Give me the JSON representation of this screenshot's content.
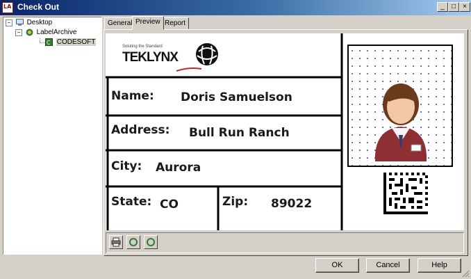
{
  "window": {
    "title": "Check Out",
    "app_icon_text": "LA",
    "controls": {
      "minimize": "_",
      "restore": "□",
      "close": "×"
    }
  },
  "tree": {
    "items": [
      {
        "label": "Desktop",
        "expander": "−",
        "icon": "desktop-icon"
      },
      {
        "label": "LabelArchive",
        "expander": "−",
        "icon": "label-archive-icon"
      },
      {
        "label": "CODESOFT",
        "icon": "codesoft-icon",
        "selected": true
      }
    ]
  },
  "tabs": [
    {
      "label": "General"
    },
    {
      "label": "Preview",
      "active": true
    },
    {
      "label": "Report"
    }
  ],
  "label_preview": {
    "logo_tagline": "Soluting the Standard",
    "logo_text": "TEKLYNX",
    "name_label": "Name:",
    "name_value": "Doris Samuelson",
    "address_label": "Address:",
    "address_value": "Bull Run Ranch",
    "city_label": "City:",
    "city_value": "Aurora",
    "state_label": "State:",
    "state_value": "CO",
    "zip_label": "Zip:",
    "zip_value": "89022"
  },
  "preview_toolbar": {
    "buttons": [
      {
        "icon": "print-icon"
      },
      {
        "icon": "rotate-left-icon"
      },
      {
        "icon": "rotate-right-icon"
      }
    ]
  },
  "buttons": {
    "ok": "OK",
    "cancel": "Cancel",
    "help": "Help"
  }
}
